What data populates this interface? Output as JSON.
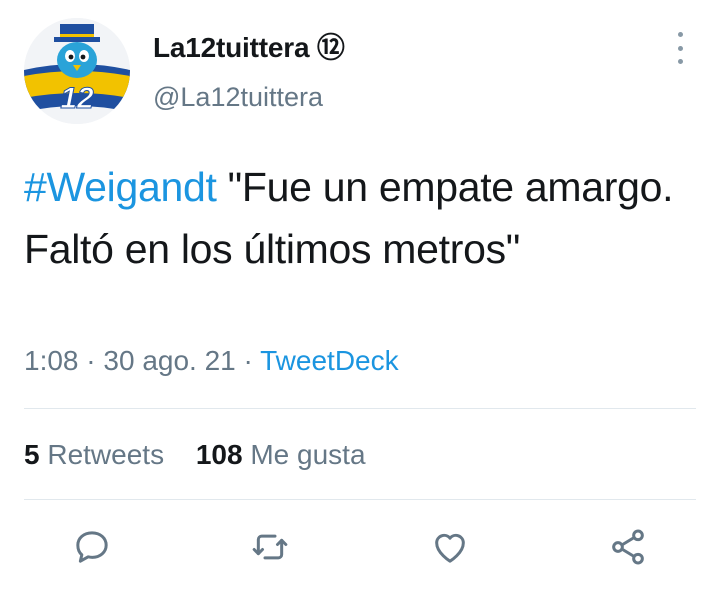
{
  "user": {
    "display_name": "La12tuittera",
    "badge": "⑫",
    "handle": "@La12tuittera"
  },
  "tweet": {
    "hashtag": "#Weigandt",
    "text": " \"Fue un empate amargo. Faltó en los últimos metros\"",
    "time": "1:08",
    "date": "30 ago. 21",
    "separator": "·",
    "source": "TweetDeck"
  },
  "stats": {
    "retweets_count": "5",
    "retweets_label": "Retweets",
    "likes_count": "108",
    "likes_label": "Me gusta"
  },
  "avatar": {
    "label": "12",
    "colors": {
      "blue": "#1f4fa0",
      "yellow": "#f2c200",
      "bird": "#2aa3d8"
    }
  },
  "icons": {
    "reply": "reply-icon",
    "retweet": "retweet-icon",
    "like": "heart-icon",
    "share": "share-icon",
    "more": "more-vertical-icon"
  },
  "colors": {
    "link": "#1b95e0",
    "secondary": "#657786",
    "text": "#14171a",
    "divider": "#e1e8ed"
  }
}
